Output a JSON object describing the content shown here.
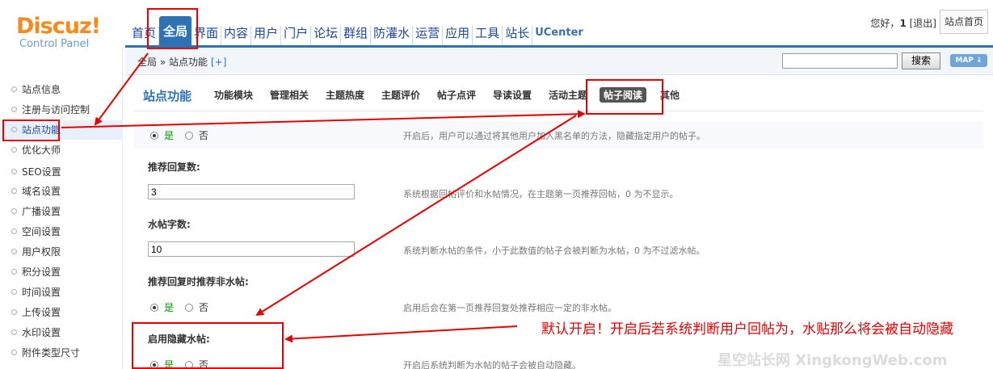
{
  "logo": {
    "brand": "Discuz!",
    "sub": "Control Panel"
  },
  "nav": {
    "items": [
      "首页",
      "全局",
      "界面",
      "内容",
      "用户",
      "门户",
      "论坛",
      "群组",
      "防灌水",
      "运营",
      "应用",
      "工具",
      "站长",
      "UCenter"
    ],
    "active": "全局"
  },
  "user": {
    "greeting": "您好，",
    "name": "1",
    "logout": "[退出]",
    "home": "站点首页"
  },
  "breadcrumb": {
    "path": "全局 » 站点功能",
    "add": "[+]"
  },
  "search": {
    "value": "",
    "button": "搜索",
    "map": "MAP ↓"
  },
  "sidebar": {
    "items": [
      "站点信息",
      "注册与访问控制",
      "站点功能",
      "优化大师",
      "SEO设置",
      "域名设置",
      "广播设置",
      "空间设置",
      "用户权限",
      "积分设置",
      "时间设置",
      "上传设置",
      "水印设置",
      "附件类型尺寸"
    ],
    "active": "站点功能"
  },
  "subnav": {
    "title": "站点功能",
    "tabs": [
      "功能模块",
      "管理相关",
      "主题热度",
      "主题评价",
      "帖子点评",
      "导读设置",
      "活动主题",
      "帖子阅读",
      "其他"
    ],
    "active": "帖子阅读"
  },
  "settings": {
    "blacklist": {
      "yes": "是",
      "no": "否",
      "tip": "开启后，用户可以通过将其他用户加入黑名单的方法，隐藏指定用户的帖子。"
    },
    "recommend_count": {
      "label": "推荐回复数:",
      "value": "3",
      "tip": "系统根据回帖评价和水帖情况，在主题第一页推荐回帖，0 为不显示。"
    },
    "water_words": {
      "label": "水帖字数:",
      "value": "10",
      "tip": "系统判断水帖的条件，小于此数值的帖子会被判断为水帖，0 为不过滤水帖。"
    },
    "recommend_non_water": {
      "label": "推荐回复时推荐非水帖:",
      "yes": "是",
      "no": "否",
      "tip": "启用后会在第一页推荐回复处推荐相应一定的非水帖。"
    },
    "hide_water": {
      "label": "启用隐藏水帖:",
      "yes": "是",
      "no": "否",
      "tip": "开启后系统判断为水帖的帖子会被自动隐藏。"
    }
  },
  "annotation": {
    "text": "默认开启！开启后若系统判断用户回帖为，水贴那么将会被自动隐藏",
    "watermark": "星空站长网 XingkongWeb.com"
  },
  "colors": {
    "accent": "#2d73b4",
    "annotation": "#e60000",
    "logo": "#f58a1f"
  }
}
